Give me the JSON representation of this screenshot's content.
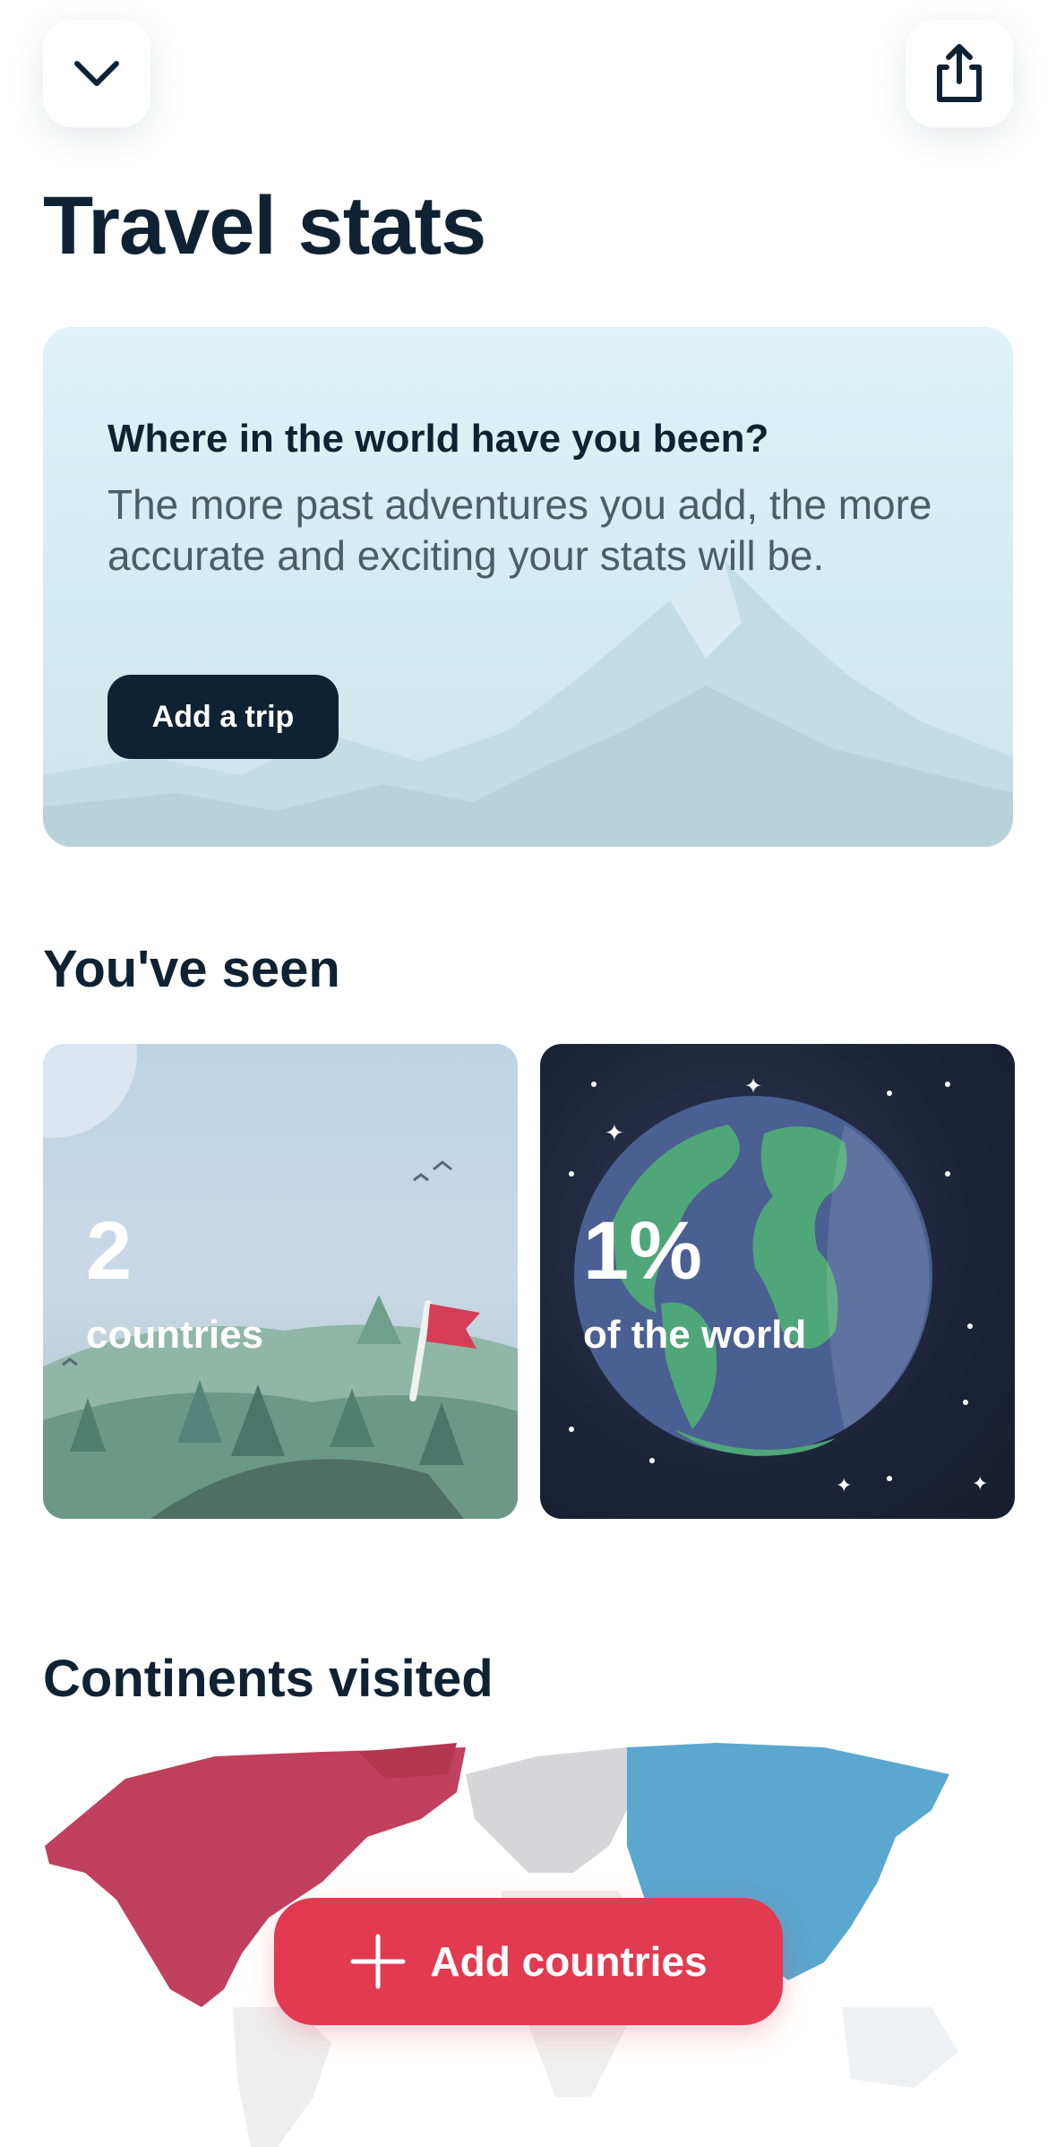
{
  "header": {
    "collapse_icon": "chevron-down-icon",
    "share_icon": "share-icon",
    "title": "Travel stats"
  },
  "hero": {
    "heading": "Where in the world have you been?",
    "body": "The more past adventures you add, the more accurate and exciting your stats will be.",
    "button_label": "Add a trip"
  },
  "seen": {
    "title": "You've seen",
    "countries_value": "2",
    "countries_label": "countries",
    "world_value": "1%",
    "world_label": "of the world"
  },
  "continents": {
    "title": "Continents visited",
    "button_label": "Add countries",
    "button_icon": "plus-icon",
    "visited_color": "#c0405e",
    "unvisited_color": "#d6d6d9",
    "asia_color": "#5aa7cf"
  },
  "colors": {
    "primary_dark": "#0f2233",
    "accent_red": "#e23a50"
  }
}
